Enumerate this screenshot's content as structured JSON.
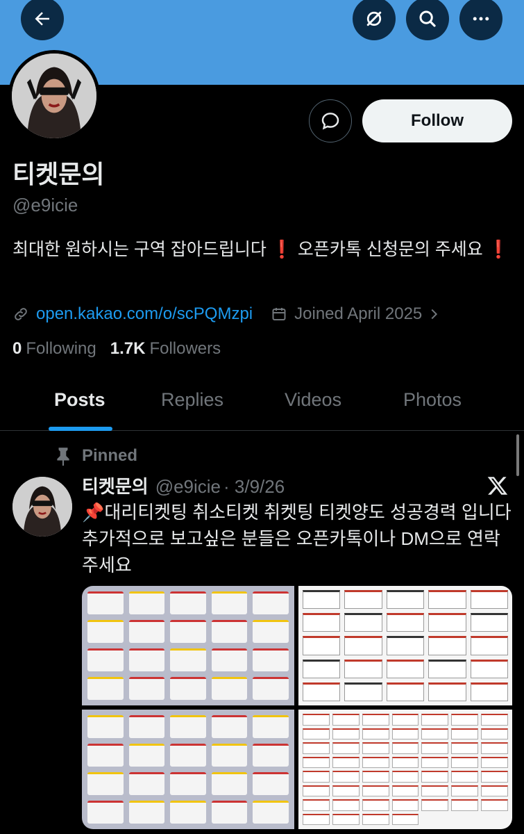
{
  "profile": {
    "display_name": "티켓문의",
    "handle": "@e9icie",
    "bio_text": "최대한 원하시는 구역 잡아드립니다",
    "bio_text_2": " 오픈카톡 신청문의 주세요",
    "bio_emoji": "❗",
    "website": "open.kakao.com/o/scPQMzpi",
    "joined": "Joined April 2025",
    "following_count": "0",
    "following_label": "Following",
    "followers_count": "1.7K",
    "followers_label": "Followers",
    "follow_label": "Follow"
  },
  "tabs": [
    {
      "label": "Posts",
      "active": true
    },
    {
      "label": "Replies",
      "active": false
    },
    {
      "label": "Videos",
      "active": false
    },
    {
      "label": "Photos",
      "active": false
    }
  ],
  "pinned_post": {
    "pinned_label": "Pinned",
    "author_name": "티켓문의",
    "author_handle": "@e9icie",
    "date": "· 3/9/26",
    "pin_emoji": "📌",
    "text": "대리티켓팅 취소티켓 취켓팅 티켓양도 성공경력 입니다 추가적으로 보고싶은 분들은 오픈카톡이나 DM으로 연락주세요",
    "media_count": 4
  },
  "colors": {
    "banner": "#4a9be0",
    "link": "#1d9bf0",
    "muted": "#71767b",
    "text": "#e7e9ea",
    "accent_red": "#e0245e"
  },
  "icons": {
    "back": "arrow-left-icon",
    "grok": "grok-icon",
    "search": "search-icon",
    "more": "more-horizontal-icon",
    "message": "message-bubble-icon",
    "link": "link-icon",
    "calendar": "calendar-icon",
    "chevron": "chevron-right-icon",
    "pin": "pin-icon",
    "x_logo": "x-logo-icon"
  }
}
